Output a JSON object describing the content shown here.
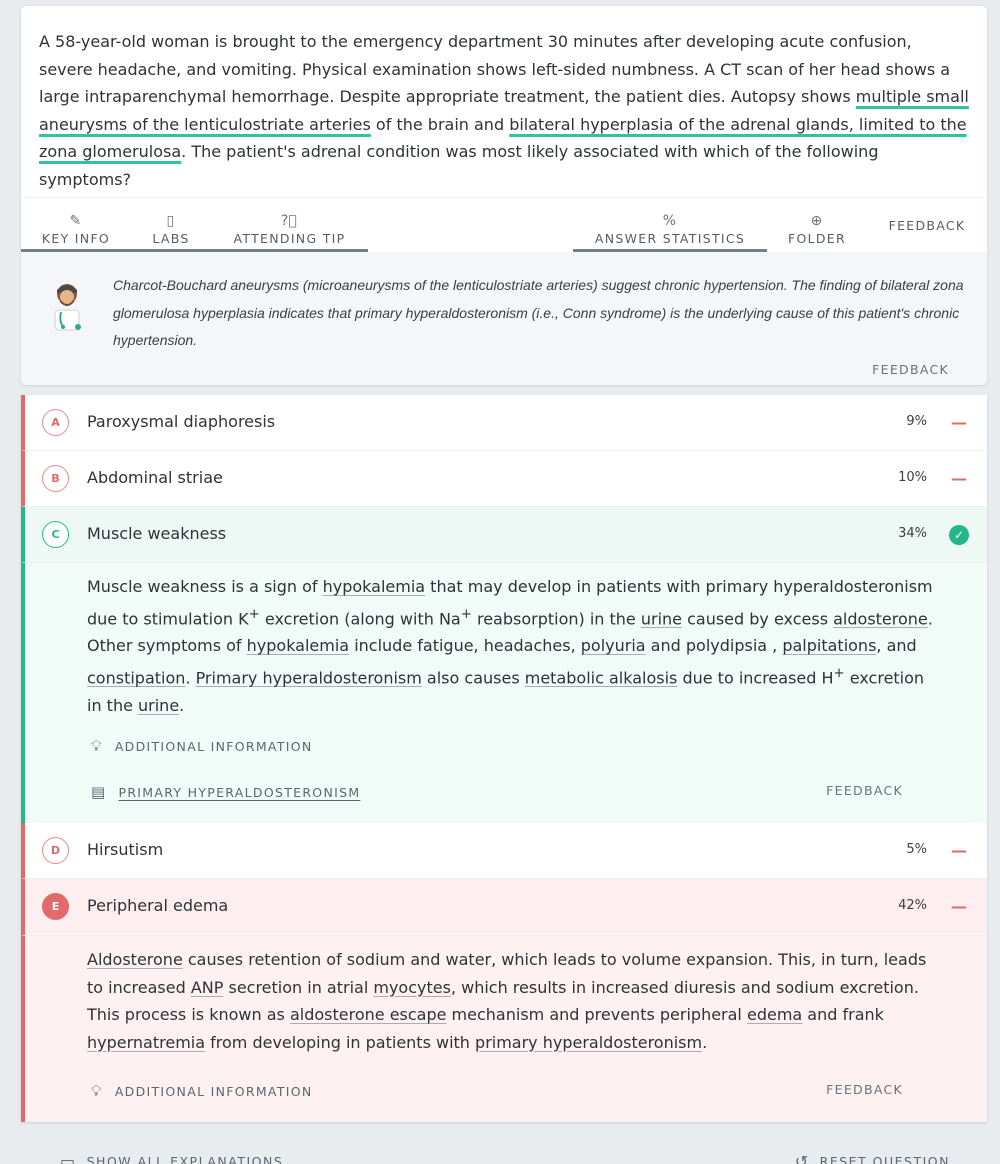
{
  "question": {
    "text_1": "A 58-year-old woman is brought to the emergency department 30 minutes after developing acute confusion, severe headache, and vomiting. Physical examination shows left-sided numbness. A CT scan of her head shows a large intraparenchymal hemorrhage. Despite appropriate treatment, the patient dies. Autopsy shows ",
    "highlight_1": "multiple small aneurysms of the lenticulostriate arteries",
    "text_2": " of the brain and ",
    "highlight_2": "bilateral hyperplasia of the adrenal glands, limited to the zona glomerulosa",
    "text_3": ". The patient's adrenal condition was most likely associated with which of the following symptoms?"
  },
  "toolbar": {
    "key_info": "KEY INFO",
    "labs": "LABS",
    "attending_tip": "ATTENDING TIP",
    "answer_statistics": "ANSWER STATISTICS",
    "folder": "FOLDER",
    "feedback": "FEEDBACK",
    "icons": {
      "key_info": "pencil-icon",
      "labs": "clipboard-icon",
      "attending_tip": "question-circle-icon",
      "answer_statistics": "percent-icon",
      "folder": "plus-circle-icon"
    }
  },
  "tip": {
    "text": "Charcot-Bouchard aneurysms (microaneurysms of the lenticulostriate arteries) suggest chronic hypertension. The finding of bilateral zona glomerulosa hyperplasia indicates that primary hyperaldosteronism (i.e., Conn syndrome) is the underlying cause of this patient's chronic hypertension.",
    "feedback": "FEEDBACK"
  },
  "options": [
    {
      "letter": "A",
      "label": "Paroxysmal diaphoresis",
      "pct": "9%",
      "mark": "—"
    },
    {
      "letter": "B",
      "label": "Abdominal striae",
      "pct": "10%",
      "mark": "—"
    },
    {
      "letter": "C",
      "label": "Muscle weakness",
      "pct": "34%",
      "mark": "✓"
    },
    {
      "letter": "D",
      "label": "Hirsutism",
      "pct": "5%",
      "mark": "—"
    },
    {
      "letter": "E",
      "label": "Peripheral edema",
      "pct": "42%",
      "mark": "—"
    }
  ],
  "explanation_c": {
    "t1": "Muscle weakness is a sign of ",
    "l1": "hypokalemia",
    "t2": " that may develop in patients with primary hyperaldosteronism due to stimulation K",
    "sup1": "+",
    "t3": " excretion (along with Na",
    "sup2": "+",
    "t4": " reabsorption) in the ",
    "l2": "urine",
    "t5": " caused by excess ",
    "l3": "aldosterone",
    "t6": ". Other symptoms of ",
    "l4": "hypokalemia",
    "t7": " include fatigue, headaches, ",
    "l5": "polyuria",
    "t8": " and polydipsia , ",
    "l6": "palpitations",
    "t9": ", and ",
    "l7": "constipation",
    "t10": ". ",
    "l8": "Primary hyperaldosteronism",
    "t11": " also causes ",
    "l9": "metabolic alkalosis",
    "t12": " due to increased H",
    "sup3": "+",
    "t13": " excretion in the ",
    "l10": "urine",
    "t14": ".",
    "additional_info": "ADDITIONAL INFORMATION",
    "article": "PRIMARY HYPERALDOSTERONISM",
    "feedback": "FEEDBACK"
  },
  "explanation_e": {
    "l1": "Aldosterone",
    "t1": " causes retention of sodium and water, which leads to volume expansion. This, in turn, leads to increased ",
    "l2": "ANP",
    "t2": " secretion in atrial ",
    "l3": "myocytes",
    "t3": ", which results in increased diuresis and sodium excretion. This process is known as ",
    "l4": "aldosterone escape",
    "t4": " mechanism and prevents peripheral ",
    "l5": "edema",
    "t5": " and frank ",
    "l6": "hypernatremia",
    "t6": " from developing in patients with ",
    "l7": "primary hyperaldosteronism",
    "t7": ".",
    "additional_info": "ADDITIONAL INFORMATION",
    "feedback": "FEEDBACK"
  },
  "bottom": {
    "show_all": "SHOW ALL EXPLANATIONS",
    "reset": "RESET QUESTION"
  },
  "colors": {
    "correct": "#22b888",
    "incorrect": "#e26a6a",
    "highlight": "#2fc49f"
  }
}
